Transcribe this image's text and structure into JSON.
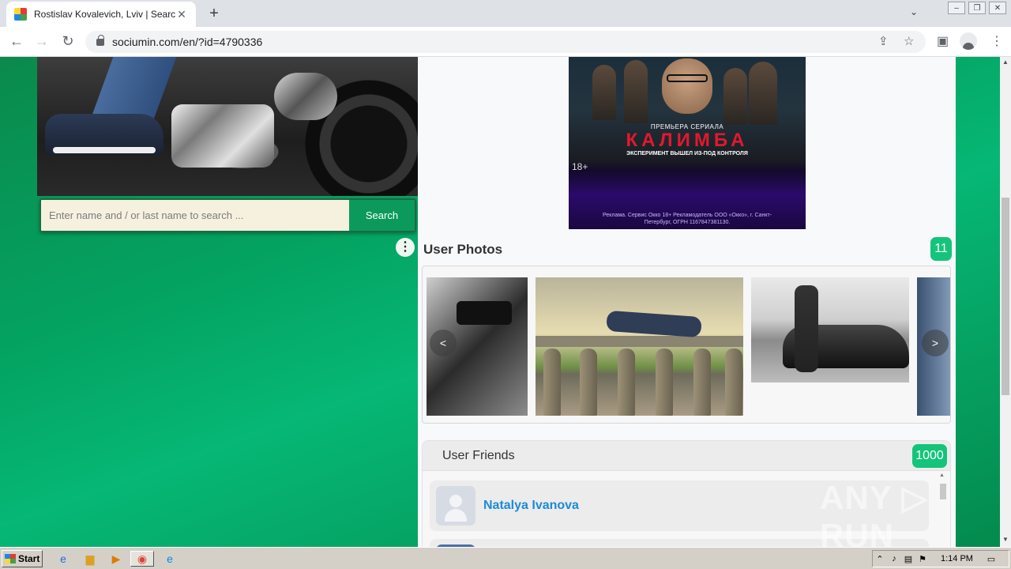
{
  "browser": {
    "tab_title": "Rostislav Kovalevich, Lviv | Search I",
    "tab_close": "✕",
    "new_tab": "+",
    "tab_menu": "⌄",
    "url": "sociumin.com/en/?id=4790336",
    "window_buttons": [
      "–",
      "❐",
      "✕"
    ]
  },
  "search": {
    "placeholder": "Enter name and / or last name to search ...",
    "button_label": "Search"
  },
  "more_menu_glyph": "⋮",
  "ad": {
    "tagline": "ПРЕМЬЕРА СЕРИАЛА",
    "title": "КАЛИМБА",
    "subtitle": "ЭКСПЕРИМЕНТ ВЫШЕЛ ИЗ-ПОД КОНТРОЛЯ",
    "age_rating": "18+",
    "legal": "Реклама. Сервис Окко 18+ Рекламодатель ООО «Окко», г. Санкт-Петербург, ОГРН 1167847381130."
  },
  "photos": {
    "heading": "User Photos",
    "count": "11",
    "prev": "<",
    "next": ">"
  },
  "friends": {
    "heading": "User Friends",
    "count": "1000",
    "items": [
      {
        "name": "Natalya Ivanova"
      }
    ]
  },
  "watermark": "ANY ▷ RUN",
  "taskbar": {
    "start_label": "Start",
    "clock": "1:14 PM"
  }
}
